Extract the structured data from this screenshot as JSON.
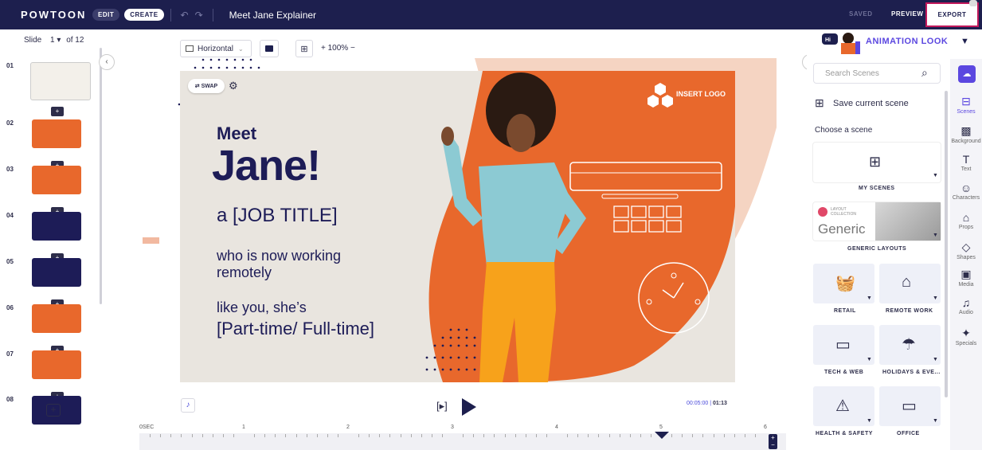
{
  "topbar": {
    "logo": "POWTOON",
    "mode_edit": "EDIT",
    "mode_create": "CREATE",
    "title": "Meet Jane Explainer",
    "saved": "SAVED",
    "preview": "PREVIEW",
    "export": "EXPORT"
  },
  "slides_panel": {
    "slide_label": "Slide",
    "current": "1",
    "total": "of 12",
    "items": [
      {
        "num": "01",
        "color": "#ffffff"
      },
      {
        "num": "02",
        "color": "#e8682c"
      },
      {
        "num": "03",
        "color": "#e8682c"
      },
      {
        "num": "04",
        "color": "#1d1c57"
      },
      {
        "num": "05",
        "color": "#1d1c57"
      },
      {
        "num": "06",
        "color": "#e8682c"
      },
      {
        "num": "07",
        "color": "#e8682c"
      },
      {
        "num": "08",
        "color": "#1d1c57"
      }
    ],
    "add_slide": "+"
  },
  "toolbar": {
    "orientation": "Horizontal",
    "zoom": "+ 100% −"
  },
  "stage": {
    "swap": "⇄ SWAP",
    "meet": "Meet",
    "jane": "Jane!",
    "job_title": "a [JOB TITLE]",
    "who_is": "who is now working remotely",
    "like_you": "like you, she’s",
    "part_time": "[Part-time/ Full-time]",
    "insert_logo": "INSERT LOGO"
  },
  "playback": {
    "current_time": "00:05:00",
    "total_time": "01:13",
    "play_frame": "[▸]"
  },
  "timeline": {
    "ticks": [
      "0SEC",
      "1",
      "2",
      "3",
      "4",
      "5",
      "6"
    ]
  },
  "right_panel": {
    "animation_look": "ANIMATION LOOK",
    "search_placeholder": "Search Scenes",
    "save_scene": "Save current scene",
    "choose_scene": "Choose a scene",
    "my_scenes": "MY SCENES",
    "layout_collection": "LAYOUT COLLECTION",
    "generic": "Generic",
    "generic_layouts": "GENERIC LAYOUTS",
    "categories": [
      "RETAIL",
      "REMOTE WORK",
      "TECH & WEB",
      "HOLIDAYS & EVE...",
      "HEALTH & SAFETY",
      "OFFICE"
    ]
  },
  "iconbar": {
    "items": [
      "Scenes",
      "Background",
      "Text",
      "Characters",
      "Props",
      "Shapes",
      "Media",
      "Audio",
      "Specials"
    ]
  },
  "colors": {
    "navy": "#1d1f4e",
    "orange": "#e8682c",
    "accent": "#5b47e0",
    "stage_bg": "#e9e5df"
  }
}
